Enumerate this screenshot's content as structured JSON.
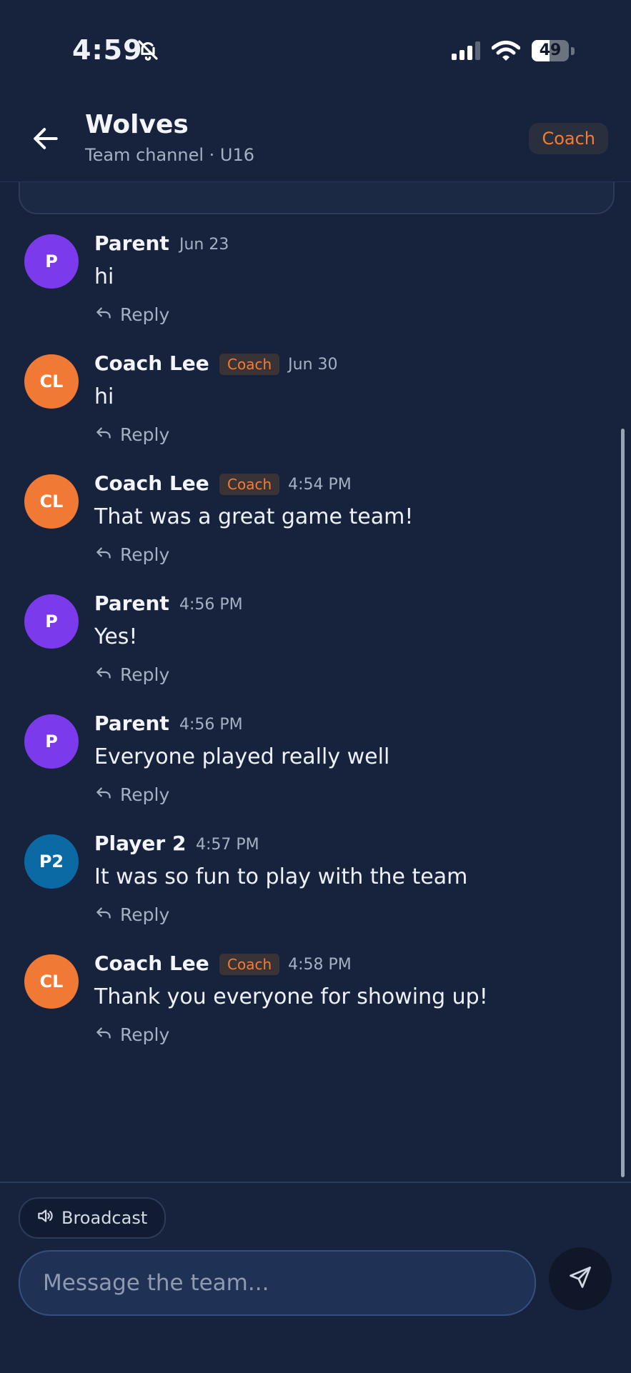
{
  "status_bar": {
    "time": "4:59",
    "battery_percent": "49",
    "battery_level": 0.49,
    "signal_bars": 3,
    "icons": [
      "bell-slash-icon",
      "signal-icon",
      "wifi-icon",
      "battery-icon"
    ]
  },
  "header": {
    "title": "Wolves",
    "subtitle": "Team channel · U16",
    "role": "Coach",
    "back_icon": "arrow-left-icon"
  },
  "messages": [
    {
      "initials": "P",
      "author": "Parent",
      "badge": "",
      "time": "Jun 23",
      "text": "hi",
      "reply_label": "Reply",
      "avatar_color": "#7c3aed"
    },
    {
      "initials": "CL",
      "author": "Coach Lee",
      "badge": "Coach",
      "time": "Jun 30",
      "text": "hi",
      "reply_label": "Reply",
      "avatar_color": "#f07a35"
    },
    {
      "initials": "CL",
      "author": "Coach Lee",
      "badge": "Coach",
      "time": "4:54 PM",
      "text": "That was a great game team!",
      "reply_label": "Reply",
      "avatar_color": "#f07a35"
    },
    {
      "initials": "P",
      "author": "Parent",
      "badge": "",
      "time": "4:56 PM",
      "text": "Yes!",
      "reply_label": "Reply",
      "avatar_color": "#7c3aed"
    },
    {
      "initials": "P",
      "author": "Parent",
      "badge": "",
      "time": "4:56 PM",
      "text": "Everyone played really well",
      "reply_label": "Reply",
      "avatar_color": "#7c3aed"
    },
    {
      "initials": "P2",
      "author": "Player 2",
      "badge": "",
      "time": "4:57 PM",
      "text": "It was so fun to play with the team",
      "reply_label": "Reply",
      "avatar_color": "#0b69a3"
    },
    {
      "initials": "CL",
      "author": "Coach Lee",
      "badge": "Coach",
      "time": "4:58 PM",
      "text": "Thank you everyone for showing up!",
      "reply_label": "Reply",
      "avatar_color": "#f07a35"
    }
  ],
  "composer": {
    "broadcast_label": "Broadcast",
    "placeholder": "Message the team...",
    "value": ""
  },
  "colors": {
    "background": "#17233d",
    "accent": "#f57c32"
  }
}
